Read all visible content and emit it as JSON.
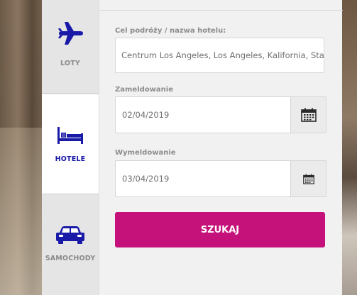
{
  "tabs": {
    "flights": {
      "label": "LOTY",
      "icon": "airplane-icon"
    },
    "hotels": {
      "label": "HOTELE",
      "icon": "bed-icon"
    },
    "cars": {
      "label": "SAMOCHODY",
      "icon": "car-icon"
    },
    "active": "hotels"
  },
  "form": {
    "destination_label": "Cel podróży / nazwa hotelu:",
    "destination_value": "Centrum Los Angeles, Los Angeles, Kalifornia, Stan",
    "checkin_label": "Zameldowanie",
    "checkin_value": "02/04/2019",
    "checkout_label": "Wymeldowanie",
    "checkout_value": "03/04/2019",
    "search_label": "SZUKAJ"
  },
  "colors": {
    "accent": "#c5127a",
    "active_icon": "#1a1aa8",
    "panel_bg": "#f1f1f1",
    "sidebar_bg": "#e5e5e5"
  }
}
